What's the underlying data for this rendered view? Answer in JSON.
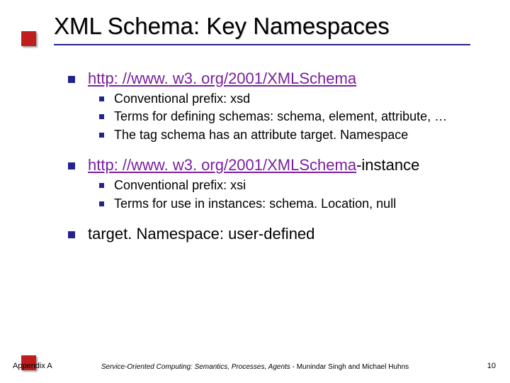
{
  "title": "XML Schema: Key Namespaces",
  "items": [
    {
      "heading": {
        "link": "http: //www. w3. org/2001/XMLSchema",
        "suffix": ""
      },
      "sub": [
        "Conventional prefix: xsd",
        "Terms for defining schemas: schema, element, attribute, …",
        "The tag schema has an attribute target. Namespace"
      ]
    },
    {
      "heading": {
        "link": "http: //www. w3. org/2001/XMLSchema",
        "suffix": "-instance"
      },
      "sub": [
        "Conventional prefix: xsi",
        "Terms for use in instances: schema. Location, null"
      ]
    },
    {
      "heading": {
        "plain": "target. Namespace: user-defined"
      },
      "sub": []
    }
  ],
  "footer": {
    "left": "Appendix A",
    "center_italic": "Service-Oriented Computing: Semantics, Processes, Agents",
    "center_rest": " - Munindar Singh and Michael Huhns",
    "right": "10"
  }
}
